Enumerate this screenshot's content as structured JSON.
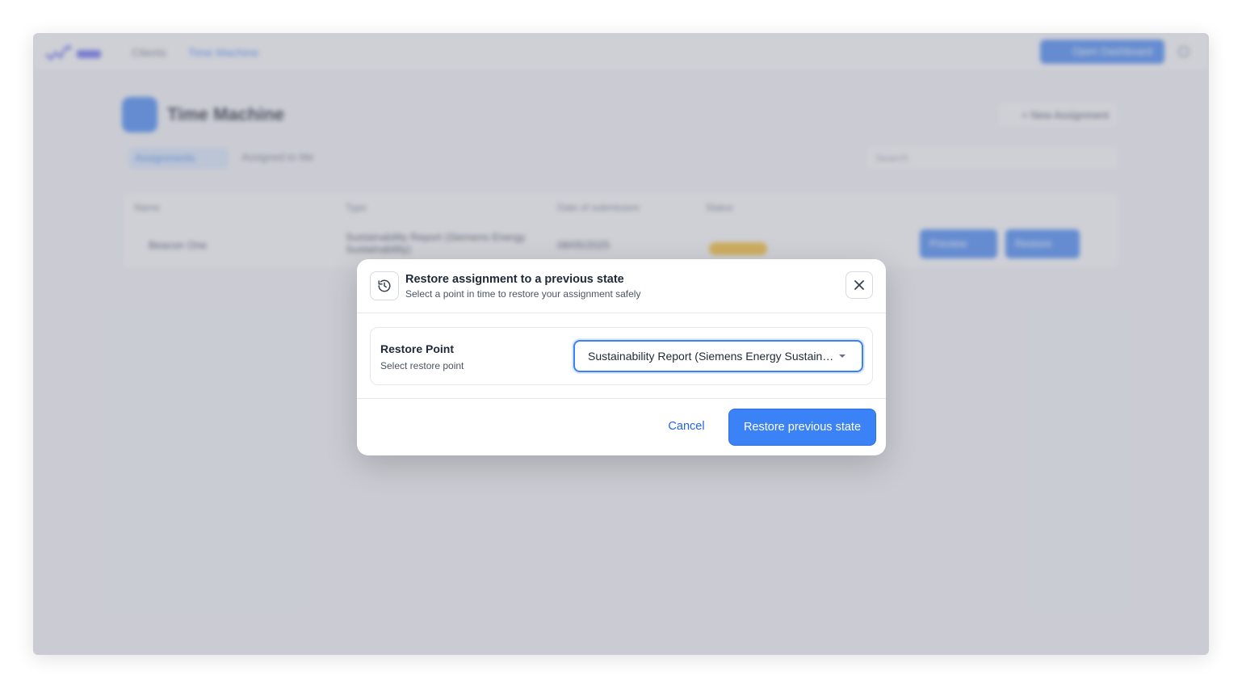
{
  "background": {
    "nav": [
      "Clients",
      "Time Machine"
    ],
    "top_button": "Open Dashboard",
    "page_title": "Time Machine",
    "new_button": "+ New Assignment",
    "tabs": [
      "Assignments",
      "Assigned to Me"
    ],
    "search_placeholder": "Search",
    "columns": [
      "Name",
      "Type",
      "Date of submission",
      "Status"
    ],
    "row": {
      "name": "Beacon One",
      "type": "Sustainability Report (Siemens Energy Sustainability)",
      "date": "08/05/2025",
      "action_1": "Preview",
      "action_2": "Restore"
    }
  },
  "modal": {
    "icon": "history-icon",
    "title": "Restore assignment to a previous state",
    "subtitle": "Select a point in time to restore your assignment safely",
    "close_icon": "close-icon",
    "field": {
      "label": "Restore Point",
      "help": "Select restore point",
      "selected_value": "Sustainability Report (Siemens Energy Sustainability)"
    },
    "cancel_label": "Cancel",
    "restore_label": "Restore previous state"
  },
  "colors": {
    "accent": "#3b82f6",
    "link": "#2563eb",
    "text": "#1f2937",
    "muted": "#4b5563",
    "badge": "#fbbf24"
  }
}
